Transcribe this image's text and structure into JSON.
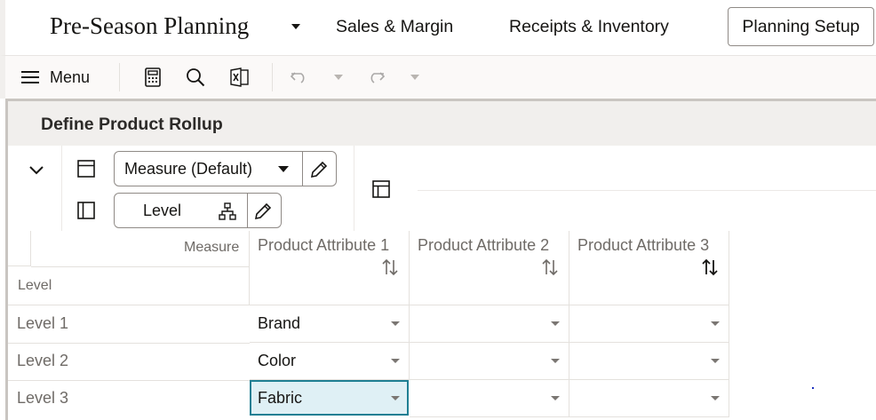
{
  "app": {
    "title": "Pre-Season Planning",
    "nav": [
      "Sales & Margin",
      "Receipts & Inventory",
      "Planning Setup"
    ],
    "active_nav": "Planning Setup"
  },
  "toolbar": {
    "menu_label": "Menu",
    "icons": [
      "calculator-icon",
      "search-icon",
      "excel-icon",
      "undo-icon",
      "redo-icon"
    ]
  },
  "panel": {
    "title": "Define Product Rollup"
  },
  "pivot": {
    "columns_selector": "Measure (Default)",
    "rows_selector": "Level"
  },
  "grid": {
    "corner_col_label": "Measure",
    "corner_row_label": "Level",
    "columns": [
      "Product Attribute 1",
      "Product Attribute 2",
      "Product Attribute 3"
    ],
    "rows": [
      {
        "label": "Level 1",
        "values": [
          "Brand",
          "",
          ""
        ]
      },
      {
        "label": "Level 2",
        "values": [
          "Color",
          "",
          ""
        ]
      },
      {
        "label": "Level 3",
        "values": [
          "Fabric",
          "",
          ""
        ]
      }
    ],
    "selected_cell": "Level 3 / Product Attribute 1"
  },
  "colors": {
    "accent": "#1f7f93",
    "selected_bg": "#dff0f5",
    "header_bg": "#f1efed"
  }
}
